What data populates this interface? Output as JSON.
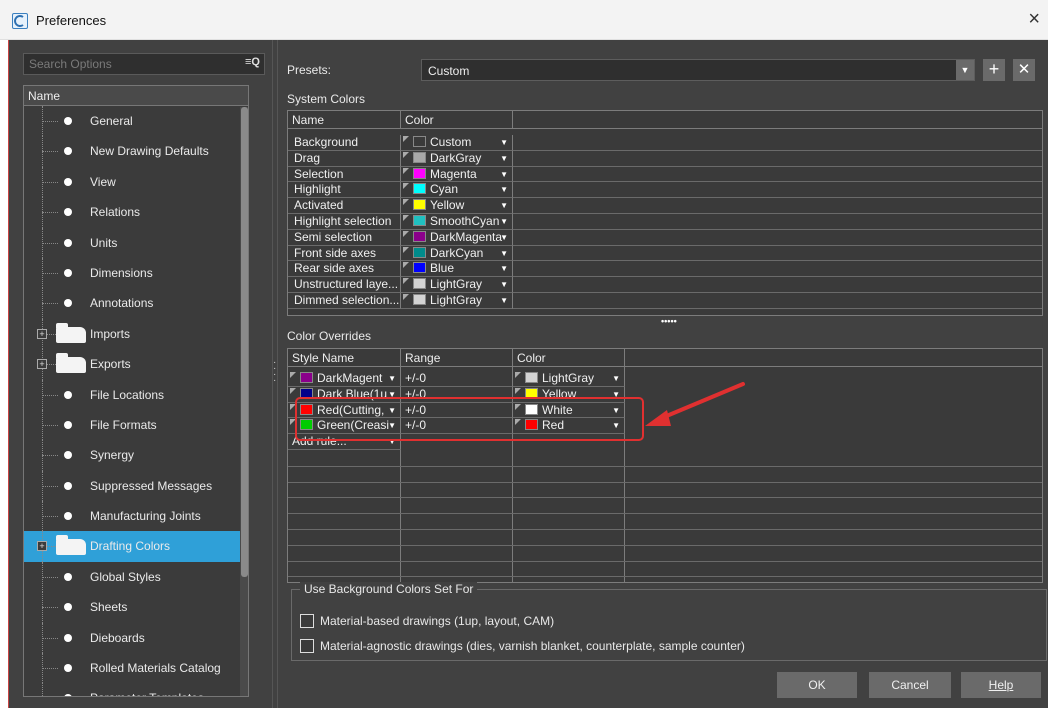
{
  "window": {
    "title": "Preferences",
    "close_glyph": "×"
  },
  "search": {
    "placeholder": "Search Options",
    "icon": "search-filter-icon"
  },
  "tree": {
    "header": "Name",
    "items": [
      {
        "label": "General",
        "type": "leaf"
      },
      {
        "label": "New Drawing Defaults",
        "type": "leaf"
      },
      {
        "label": "View",
        "type": "leaf"
      },
      {
        "label": "Relations",
        "type": "leaf"
      },
      {
        "label": "Units",
        "type": "leaf"
      },
      {
        "label": "Dimensions",
        "type": "leaf"
      },
      {
        "label": "Annotations",
        "type": "leaf"
      },
      {
        "label": "Imports",
        "type": "folder"
      },
      {
        "label": "Exports",
        "type": "folder"
      },
      {
        "label": "File Locations",
        "type": "leaf"
      },
      {
        "label": "File Formats",
        "type": "leaf"
      },
      {
        "label": "Synergy",
        "type": "leaf"
      },
      {
        "label": "Suppressed Messages",
        "type": "leaf"
      },
      {
        "label": "Manufacturing Joints",
        "type": "leaf"
      },
      {
        "label": "Drafting Colors",
        "type": "folder",
        "selected": true
      },
      {
        "label": "Global Styles",
        "type": "leaf"
      },
      {
        "label": "Sheets",
        "type": "leaf"
      },
      {
        "label": "Dieboards",
        "type": "leaf"
      },
      {
        "label": "Rolled Materials Catalog",
        "type": "leaf"
      },
      {
        "label": "Parameter Templates",
        "type": "leaf"
      }
    ]
  },
  "presets": {
    "label": "Presets:",
    "value": "Custom",
    "add_glyph": "+",
    "remove_glyph": "✕"
  },
  "system_colors": {
    "title": "System Colors",
    "headers": [
      "Name",
      "Color"
    ],
    "rows": [
      {
        "name": "Background",
        "color": "Custom",
        "hex": "#3a3a3a"
      },
      {
        "name": "Drag",
        "color": "DarkGray",
        "hex": "#a9a9a9"
      },
      {
        "name": "Selection",
        "color": "Magenta",
        "hex": "#ff00ff"
      },
      {
        "name": "Highlight",
        "color": "Cyan",
        "hex": "#00ffff"
      },
      {
        "name": "Activated",
        "color": "Yellow",
        "hex": "#ffff00"
      },
      {
        "name": "Highlight selection",
        "color": "SmoothCyan",
        "hex": "#20c0c0"
      },
      {
        "name": "Semi selection",
        "color": "DarkMagenta",
        "hex": "#8b008b"
      },
      {
        "name": "Front side axes",
        "color": "DarkCyan",
        "hex": "#008b8b"
      },
      {
        "name": "Rear side axes",
        "color": "Blue",
        "hex": "#0000ff"
      },
      {
        "name": "Unstructured laye...",
        "color": "LightGray",
        "hex": "#d3d3d3"
      },
      {
        "name": "Dimmed selection...",
        "color": "LightGray",
        "hex": "#d3d3d3"
      }
    ]
  },
  "splitter_dots": "•••••",
  "overrides": {
    "title": "Color Overrides",
    "headers": [
      "Style Name",
      "Range",
      "Color"
    ],
    "rows": [
      {
        "style": "DarkMagent",
        "style_hex": "#8b008b",
        "range": "+/-0",
        "color": "LightGray",
        "hex": "#d3d3d3"
      },
      {
        "style": "Dark Blue(1u",
        "style_hex": "#00008b",
        "range": "+/-0",
        "color": "Yellow",
        "hex": "#ffff00"
      },
      {
        "style": "Red(Cutting,",
        "style_hex": "#ff0000",
        "range": "+/-0",
        "color": "White",
        "hex": "#ffffff"
      },
      {
        "style": "Green(Creasi",
        "style_hex": "#00cc00",
        "range": "+/-0",
        "color": "Red",
        "hex": "#ff0000"
      }
    ],
    "add_rule": "Add rule..."
  },
  "background_set": {
    "title": "Use Background Colors Set For",
    "options": [
      {
        "label": "Material-based drawings (1up, layout, CAM)",
        "checked": false
      },
      {
        "label": "Material-agnostic drawings (dies, varnish blanket, counterplate, sample counter)",
        "checked": false
      }
    ]
  },
  "buttons": {
    "ok": "OK",
    "cancel": "Cancel",
    "help": "Help"
  },
  "colors": {
    "accent": "#2fa0d8",
    "annotation": "#e03030",
    "panel": "#414141"
  }
}
